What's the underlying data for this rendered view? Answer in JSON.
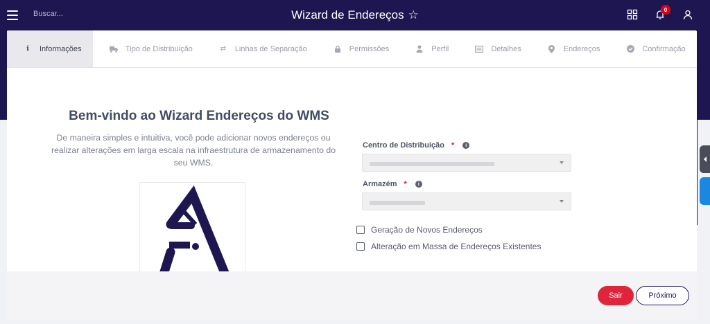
{
  "header": {
    "search_placeholder": "Buscar...",
    "title": "Wizard de Endereços",
    "notifications_count": "0"
  },
  "tabs": [
    {
      "label": "Informações",
      "icon": "info-icon",
      "active": true
    },
    {
      "label": "Tipo de Distribuição",
      "icon": "truck-icon"
    },
    {
      "label": "Linhas de Separação",
      "icon": "arrows-icon"
    },
    {
      "label": "Permissões",
      "icon": "lock-icon"
    },
    {
      "label": "Perfil",
      "icon": "user-icon"
    },
    {
      "label": "Detalhes",
      "icon": "card-icon"
    },
    {
      "label": "Endereços",
      "icon": "map-marker-icon"
    },
    {
      "label": "Confirmação",
      "icon": "check-circle-icon"
    }
  ],
  "welcome": {
    "title": "Bem-vindo ao Wizard Endereços do WMS",
    "text": "De maneira simples e intuitiva, você pode adicionar novos endereços ou realizar alterações em larga escala na infraestrutura de armazenamento do seu WMS."
  },
  "form": {
    "centro_label": "Centro de Distribuição",
    "armazem_label": "Armazém",
    "required_mark": "*",
    "option_new": "Geração de Novos Endereços",
    "option_mass": "Alteração em Massa de Endereços Existentes"
  },
  "footer": {
    "exit_label": "Sair",
    "next_label": "Próximo"
  },
  "colors": {
    "brand": "#1e1650",
    "danger": "#e0243a",
    "accent_blue": "#1a88e0"
  }
}
